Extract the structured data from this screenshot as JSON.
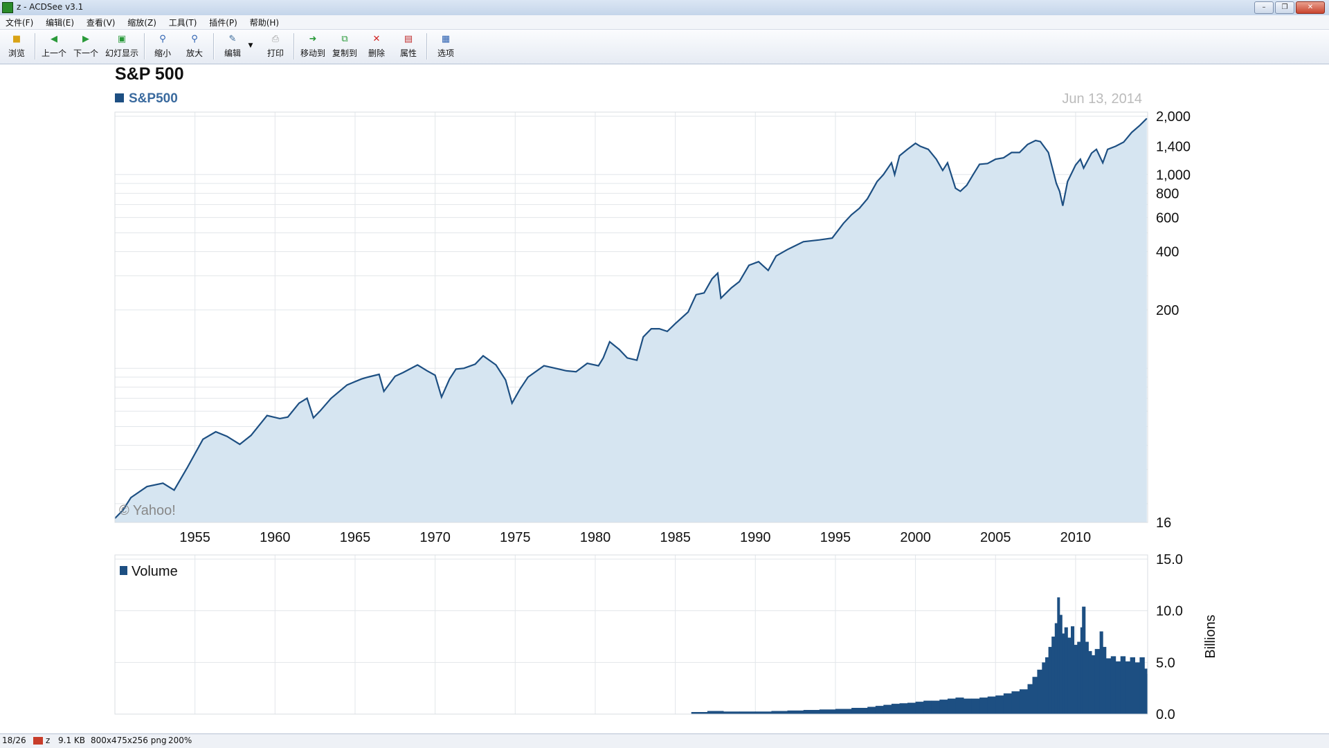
{
  "window": {
    "title": "z - ACDSee v3.1"
  },
  "menu": [
    "文件(F)",
    "编辑(E)",
    "查看(V)",
    "缩放(Z)",
    "工具(T)",
    "插件(P)",
    "帮助(H)"
  ],
  "toolbar": {
    "browse": "浏览",
    "prev": "上一个",
    "next": "下一个",
    "slideshow": "幻灯显示",
    "zoom_out": "缩小",
    "zoom_in": "放大",
    "edit": "编辑",
    "print": "打印",
    "move_to": "移动到",
    "copy_to": "复制到",
    "delete": "删除",
    "properties": "属性",
    "options": "选项"
  },
  "status": {
    "position": "18/26",
    "name": "z",
    "size": "9.1 KB",
    "info": "800x475x256 png",
    "zoom": "200%"
  },
  "colors": {
    "line": "#1d4f82",
    "area": "#d6e5f1",
    "bar": "#1d4f82",
    "grid": "#e2e6ea",
    "date": "#bbbbbb"
  },
  "chart_data": [
    {
      "type": "area",
      "title": "S&P 500",
      "legend": [
        "S&P500"
      ],
      "date_label": "Jun 13, 2014",
      "watermark": "© Yahoo!",
      "yscale": "log",
      "ylim": [
        16,
        2000
      ],
      "yticks": [
        "2,000",
        "1,400",
        "1,000",
        "800",
        "600",
        "400",
        "200",
        "16"
      ],
      "ytick_values": [
        2000,
        1400,
        1000,
        800,
        600,
        400,
        200,
        16
      ],
      "xlim": [
        1950,
        2014.5
      ],
      "xticks": [
        "1955",
        "1960",
        "1965",
        "1970",
        "1975",
        "1980",
        "1985",
        "1990",
        "1995",
        "2000",
        "2005",
        "2010"
      ],
      "series": [
        {
          "name": "S&P500",
          "x": [
            1950.0,
            1950.5,
            1951.0,
            1952.0,
            1953.0,
            1953.7,
            1954.5,
            1955.5,
            1956.3,
            1957.0,
            1957.8,
            1958.5,
            1959.5,
            1960.3,
            1960.8,
            1961.5,
            1962.0,
            1962.4,
            1962.8,
            1963.5,
            1964.5,
            1965.4,
            1965.8,
            1966.5,
            1966.8,
            1967.5,
            1968.0,
            1968.9,
            1969.5,
            1970.0,
            1970.4,
            1970.9,
            1971.3,
            1971.8,
            1972.5,
            1973.0,
            1973.8,
            1974.4,
            1974.8,
            1975.3,
            1975.8,
            1976.8,
            1977.5,
            1978.2,
            1978.8,
            1979.5,
            1980.2,
            1980.5,
            1980.9,
            1981.5,
            1982.0,
            1982.6,
            1983.0,
            1983.5,
            1984.0,
            1984.5,
            1985.0,
            1985.8,
            1986.3,
            1986.8,
            1987.3,
            1987.65,
            1987.85,
            1988.5,
            1989.0,
            1989.6,
            1990.2,
            1990.8,
            1991.3,
            1992.0,
            1993.0,
            1994.0,
            1994.8,
            1995.5,
            1996.0,
            1996.5,
            1997.0,
            1997.6,
            1998.0,
            1998.5,
            1998.7,
            1999.0,
            1999.5,
            2000.0,
            2000.3,
            2000.8,
            2001.3,
            2001.7,
            2002.0,
            2002.5,
            2002.8,
            2003.2,
            2003.6,
            2004.0,
            2004.5,
            2005.0,
            2005.5,
            2006.0,
            2006.5,
            2007.0,
            2007.5,
            2007.8,
            2008.3,
            2008.8,
            2009.0,
            2009.2,
            2009.5,
            2010.0,
            2010.3,
            2010.5,
            2011.0,
            2011.3,
            2011.7,
            2012.0,
            2012.5,
            2013.0,
            2013.5,
            2014.0,
            2014.45
          ],
          "values": [
            16.8,
            18.5,
            21.5,
            24.5,
            25.5,
            23.5,
            30.5,
            43,
            47,
            44.5,
            40.5,
            45,
            57,
            55,
            56,
            66,
            70,
            55.5,
            60,
            70,
            82,
            88,
            90,
            93,
            76,
            91,
            95,
            104,
            97,
            92,
            71,
            88,
            99,
            100,
            105,
            116,
            104,
            87,
            66,
            78,
            90,
            103,
            100,
            97,
            96,
            106,
            103,
            113,
            137,
            125,
            113,
            110,
            145,
            160,
            160,
            155,
            170,
            195,
            240,
            245,
            290,
            310,
            230,
            260,
            280,
            340,
            355,
            320,
            380,
            410,
            450,
            460,
            470,
            560,
            620,
            670,
            750,
            920,
            1000,
            1150,
            1000,
            1250,
            1350,
            1450,
            1400,
            1350,
            1200,
            1050,
            1150,
            850,
            820,
            880,
            1000,
            1130,
            1140,
            1200,
            1220,
            1300,
            1300,
            1430,
            1500,
            1480,
            1300,
            900,
            820,
            690,
            920,
            1120,
            1200,
            1080,
            1290,
            1350,
            1150,
            1350,
            1400,
            1470,
            1650,
            1790,
            1950
          ]
        }
      ]
    },
    {
      "type": "bar",
      "legend": [
        "Volume"
      ],
      "ylabel": "Billions",
      "ylim": [
        0,
        15
      ],
      "yticks": [
        "15.0",
        "10.0",
        "5.0",
        "0.0"
      ],
      "ytick_values": [
        15,
        10,
        5,
        0
      ],
      "series": [
        {
          "name": "Volume",
          "x": [
            1986.0,
            1987.0,
            1988.0,
            1989.0,
            1990.0,
            1991.0,
            1992.0,
            1993.0,
            1994.0,
            1995.0,
            1996.0,
            1997.0,
            1997.5,
            1998.0,
            1998.5,
            1999.0,
            1999.5,
            2000.0,
            2000.5,
            2001.0,
            2001.5,
            2002.0,
            2002.5,
            2003.0,
            2003.5,
            2004.0,
            2004.5,
            2005.0,
            2005.5,
            2006.0,
            2006.5,
            2007.0,
            2007.3,
            2007.6,
            2007.9,
            2008.1,
            2008.3,
            2008.5,
            2008.7,
            2008.85,
            2009.0,
            2009.15,
            2009.3,
            2009.5,
            2009.7,
            2009.9,
            2010.1,
            2010.3,
            2010.4,
            2010.6,
            2010.8,
            2011.0,
            2011.2,
            2011.5,
            2011.7,
            2011.9,
            2012.2,
            2012.5,
            2012.8,
            2013.1,
            2013.4,
            2013.7,
            2014.0,
            2014.3,
            2014.45
          ],
          "values": [
            0.2,
            0.3,
            0.25,
            0.25,
            0.25,
            0.3,
            0.35,
            0.4,
            0.45,
            0.5,
            0.6,
            0.7,
            0.8,
            0.9,
            1.0,
            1.05,
            1.1,
            1.2,
            1.3,
            1.3,
            1.4,
            1.5,
            1.6,
            1.5,
            1.5,
            1.6,
            1.7,
            1.8,
            2.0,
            2.2,
            2.4,
            2.9,
            3.6,
            4.3,
            5.0,
            5.5,
            6.5,
            7.5,
            8.8,
            11.3,
            9.6,
            7.8,
            8.4,
            7.4,
            8.5,
            6.7,
            7.0,
            8.4,
            10.4,
            7.0,
            6.1,
            5.7,
            6.3,
            8.0,
            6.5,
            5.4,
            5.6,
            5.1,
            5.6,
            5.1,
            5.5,
            5.0,
            5.5,
            4.4,
            3.9
          ]
        }
      ]
    }
  ]
}
